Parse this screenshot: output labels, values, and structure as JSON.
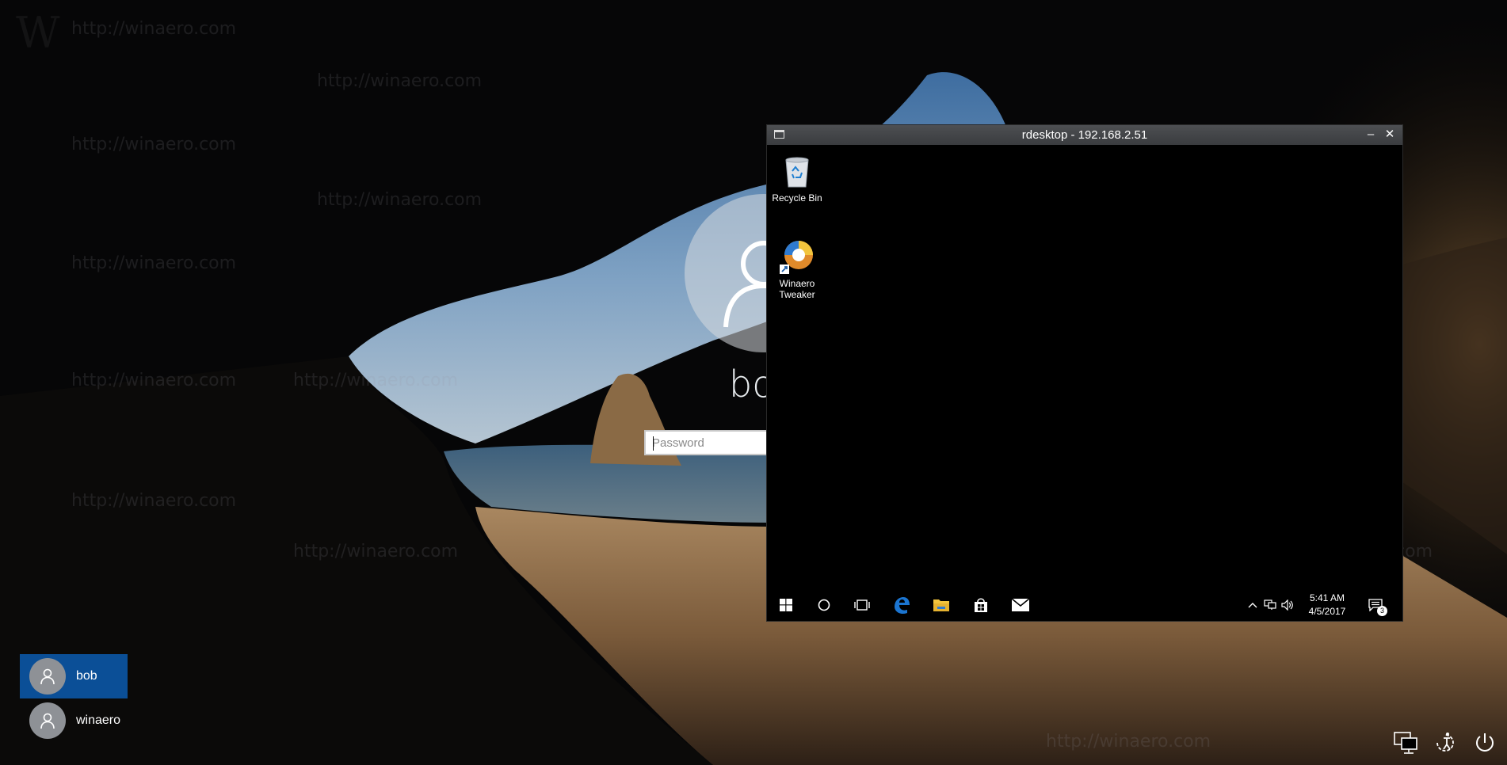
{
  "lock_screen": {
    "username": "bob",
    "password_placeholder": "Password",
    "users": [
      {
        "name": "bob",
        "selected": true
      },
      {
        "name": "winaero",
        "selected": false
      }
    ],
    "corner_icons": [
      "network-icon",
      "ease-of-access-icon",
      "power-icon"
    ]
  },
  "watermark": {
    "text": "http://winaero.com",
    "letter": "W"
  },
  "rdesktop": {
    "title": "rdesktop - 192.168.2.51",
    "minimize_label": "–",
    "close_label": "✕",
    "desktop_icons": [
      {
        "label": "Recycle Bin",
        "icon": "recycle-bin-icon"
      },
      {
        "label": "Winaero\nTweaker",
        "icon": "winaero-tweaker-icon"
      }
    ],
    "taskbar": {
      "buttons": [
        "start-icon",
        "cortana-icon",
        "task-view-icon",
        "edge-icon",
        "file-explorer-icon",
        "store-icon",
        "mail-icon"
      ],
      "time": "5:41 AM",
      "date": "4/5/2017",
      "notification_count": "3"
    }
  },
  "colors": {
    "selected_user": "#0b4f97",
    "edge_blue": "#1b75d1",
    "explorer_yellow": "#f2c43d"
  }
}
